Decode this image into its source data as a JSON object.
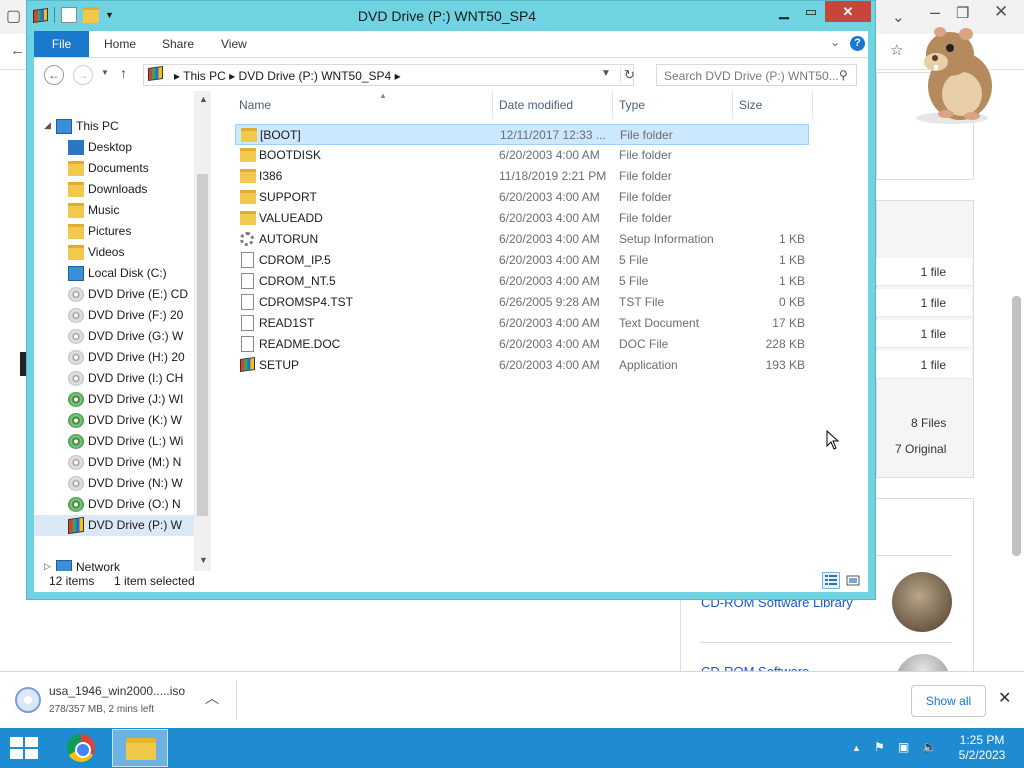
{
  "background_browser": {
    "side_rows": [
      "1 file",
      "1 file",
      "1 file",
      "1 file"
    ],
    "files_count": "8 Files",
    "original_count": "7 Original",
    "link1": "CD-ROM Software Library",
    "link2": "CD-ROM Software"
  },
  "explorer": {
    "title": "DVD Drive (P:) WNT50_SP4",
    "ribbon_tabs": [
      "File",
      "Home",
      "Share",
      "View"
    ],
    "address_parts": [
      "This PC",
      "DVD Drive (P:) WNT50_SP4"
    ],
    "search_placeholder": "Search DVD Drive (P:) WNT50...",
    "nav": [
      {
        "label": "This PC",
        "icon": "computer-icon"
      },
      {
        "label": "Desktop",
        "icon": "desktop-icon"
      },
      {
        "label": "Documents",
        "icon": "documents-icon"
      },
      {
        "label": "Downloads",
        "icon": "downloads-icon"
      },
      {
        "label": "Music",
        "icon": "music-icon"
      },
      {
        "label": "Pictures",
        "icon": "pictures-icon"
      },
      {
        "label": "Videos",
        "icon": "videos-icon"
      },
      {
        "label": "Local Disk (C:)",
        "icon": "local-disk-icon"
      },
      {
        "label": "DVD Drive (E:) CD",
        "icon": "disc-icon"
      },
      {
        "label": "DVD Drive (F:) 20",
        "icon": "disc-icon"
      },
      {
        "label": "DVD Drive (G:) W",
        "icon": "disc-icon"
      },
      {
        "label": "DVD Drive (H:) 20",
        "icon": "disc-icon"
      },
      {
        "label": "DVD Drive (I:) CH",
        "icon": "disc-icon"
      },
      {
        "label": "DVD Drive (J:) WI",
        "icon": "disc-setup-icon"
      },
      {
        "label": "DVD Drive (K:) W",
        "icon": "disc-setup-icon"
      },
      {
        "label": "DVD Drive (L:) Wi",
        "icon": "disc-setup-icon"
      },
      {
        "label": "DVD Drive (M:) N",
        "icon": "disc-icon"
      },
      {
        "label": "DVD Drive (N:) W",
        "icon": "disc-icon"
      },
      {
        "label": "DVD Drive (O:) N",
        "icon": "disc-setup-icon"
      },
      {
        "label": "DVD Drive (P:) W",
        "icon": "windows-flag-icon"
      },
      {
        "label": "Network",
        "icon": "network-icon"
      }
    ],
    "columns": [
      "Name",
      "Date modified",
      "Type",
      "Size"
    ],
    "files": [
      {
        "name": "[BOOT]",
        "date": "12/11/2017 12:33 ...",
        "type": "File folder",
        "size": "",
        "icon": "folder-icon"
      },
      {
        "name": "BOOTDISK",
        "date": "6/20/2003 4:00 AM",
        "type": "File folder",
        "size": "",
        "icon": "folder-icon"
      },
      {
        "name": "I386",
        "date": "11/18/2019 2:21 PM",
        "type": "File folder",
        "size": "",
        "icon": "folder-icon"
      },
      {
        "name": "SUPPORT",
        "date": "6/20/2003 4:00 AM",
        "type": "File folder",
        "size": "",
        "icon": "folder-icon"
      },
      {
        "name": "VALUEADD",
        "date": "6/20/2003 4:00 AM",
        "type": "File folder",
        "size": "",
        "icon": "folder-icon"
      },
      {
        "name": "AUTORUN",
        "date": "6/20/2003 4:00 AM",
        "type": "Setup Information",
        "size": "1 KB",
        "icon": "setup-info-icon"
      },
      {
        "name": "CDROM_IP.5",
        "date": "6/20/2003 4:00 AM",
        "type": "5 File",
        "size": "1 KB",
        "icon": "file-icon"
      },
      {
        "name": "CDROM_NT.5",
        "date": "6/20/2003 4:00 AM",
        "type": "5 File",
        "size": "1 KB",
        "icon": "file-icon"
      },
      {
        "name": "CDROMSP4.TST",
        "date": "6/26/2005 9:28 AM",
        "type": "TST File",
        "size": "0 KB",
        "icon": "file-icon"
      },
      {
        "name": "READ1ST",
        "date": "6/20/2003 4:00 AM",
        "type": "Text Document",
        "size": "17 KB",
        "icon": "text-file-icon"
      },
      {
        "name": "README.DOC",
        "date": "6/20/2003 4:00 AM",
        "type": "DOC File",
        "size": "228 KB",
        "icon": "doc-file-icon"
      },
      {
        "name": "SETUP",
        "date": "6/20/2003 4:00 AM",
        "type": "Application",
        "size": "193 KB",
        "icon": "setup-app-icon"
      }
    ],
    "status_items": "12 items",
    "status_selected": "1 item selected"
  },
  "download": {
    "filename": "usa_1946_win2000.....iso",
    "status": "278/357 MB, 2 mins left",
    "show_all": "Show all"
  },
  "taskbar": {
    "time": "1:25 PM",
    "date": "5/2/2023"
  },
  "colors": {
    "window_frame": "#6fd3e2",
    "close_button": "#c7453b",
    "file_tab": "#1979ca",
    "taskbar": "#1f8bd1",
    "selection": "#cce8ff"
  }
}
